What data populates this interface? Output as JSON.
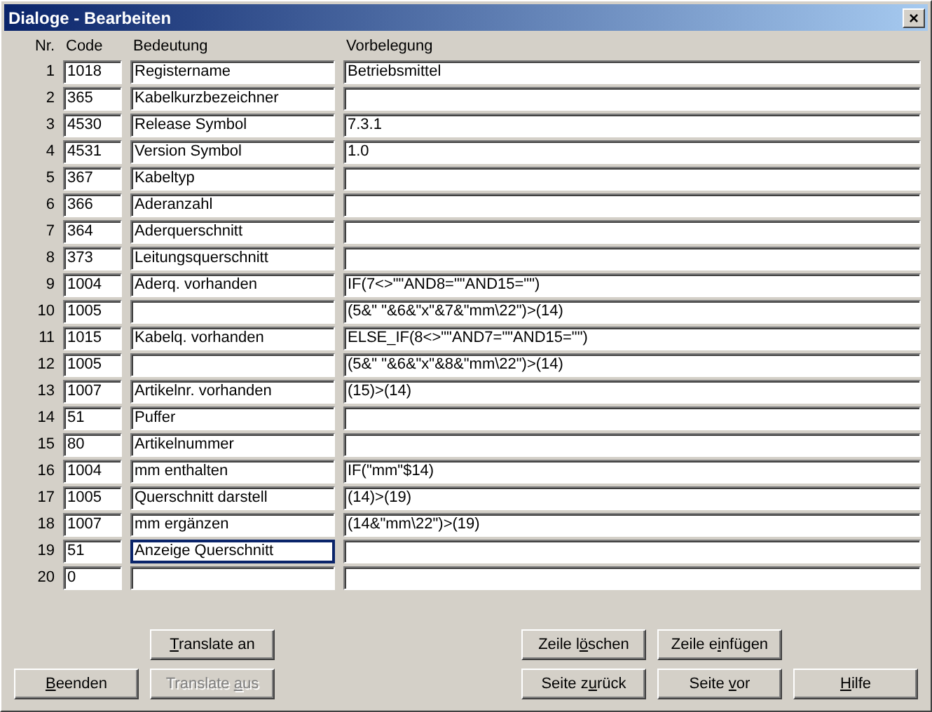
{
  "window": {
    "title": "Dialoge - Bearbeiten",
    "close": "×"
  },
  "columns": [
    "Nr.",
    "Code",
    "Bedeutung",
    "Vorbelegung"
  ],
  "rows": [
    {
      "nr": "1",
      "code": "1018",
      "bedeutung": "Registername",
      "vorbelegung": "Betriebsmittel",
      "focused": false
    },
    {
      "nr": "2",
      "code": "365",
      "bedeutung": "Kabelkurzbezeichner",
      "vorbelegung": "",
      "focused": false
    },
    {
      "nr": "3",
      "code": "4530",
      "bedeutung": "Release Symbol",
      "vorbelegung": "7.3.1",
      "focused": false
    },
    {
      "nr": "4",
      "code": "4531",
      "bedeutung": "Version  Symbol",
      "vorbelegung": "1.0",
      "focused": false
    },
    {
      "nr": "5",
      "code": "367",
      "bedeutung": "Kabeltyp",
      "vorbelegung": "",
      "focused": false
    },
    {
      "nr": "6",
      "code": "366",
      "bedeutung": "Aderanzahl",
      "vorbelegung": "",
      "focused": false
    },
    {
      "nr": "7",
      "code": "364",
      "bedeutung": "Aderquerschnitt",
      "vorbelegung": "",
      "focused": false
    },
    {
      "nr": "8",
      "code": "373",
      "bedeutung": "Leitungsquerschnitt",
      "vorbelegung": "",
      "focused": false
    },
    {
      "nr": "9",
      "code": "1004",
      "bedeutung": "Aderq. vorhanden",
      "vorbelegung": "IF(7<>\"\"AND8=\"\"AND15=\"\")",
      "focused": false
    },
    {
      "nr": "10",
      "code": "1005",
      "bedeutung": "",
      "vorbelegung": "(5&\" \"&6&\"x\"&7&\"mm\\22\")>(14)",
      "focused": false
    },
    {
      "nr": "11",
      "code": "1015",
      "bedeutung": "Kabelq. vorhanden",
      "vorbelegung": "ELSE_IF(8<>\"\"AND7=\"\"AND15=\"\")",
      "focused": false
    },
    {
      "nr": "12",
      "code": "1005",
      "bedeutung": "",
      "vorbelegung": "(5&\" \"&6&\"x\"&8&\"mm\\22\")>(14)",
      "focused": false
    },
    {
      "nr": "13",
      "code": "1007",
      "bedeutung": "Artikelnr. vorhanden",
      "vorbelegung": "(15)>(14)",
      "focused": false
    },
    {
      "nr": "14",
      "code": "51",
      "bedeutung": "Puffer",
      "vorbelegung": "",
      "focused": false
    },
    {
      "nr": "15",
      "code": "80",
      "bedeutung": "Artikelnummer",
      "vorbelegung": "",
      "focused": false
    },
    {
      "nr": "16",
      "code": "1004",
      "bedeutung": "mm enthalten",
      "vorbelegung": "IF(\"mm\"$14)",
      "focused": false
    },
    {
      "nr": "17",
      "code": "1005",
      "bedeutung": "Querschnitt darstell",
      "vorbelegung": "(14)>(19)",
      "focused": false
    },
    {
      "nr": "18",
      "code": "1007",
      "bedeutung": "mm ergänzen",
      "vorbelegung": "(14&\"mm\\22\")>(19)",
      "focused": false
    },
    {
      "nr": "19",
      "code": "51",
      "bedeutung": "Anzeige Querschnitt",
      "vorbelegung": "",
      "focused": true
    },
    {
      "nr": "20",
      "code": "0",
      "bedeutung": "",
      "vorbelegung": "",
      "focused": false
    }
  ],
  "buttons": [
    {
      "key": "T",
      "after": "ranslate an",
      "disabled": false
    },
    {
      "before": "Zeile l",
      "key": "ö",
      "after": "schen",
      "disabled": false
    },
    {
      "before": "Zeile e",
      "key": "i",
      "after": "nfügen",
      "disabled": false
    },
    {
      "key": "B",
      "after": "eenden",
      "disabled": false
    },
    {
      "before": "Translate ",
      "key": "a",
      "after": "us",
      "disabled": true
    },
    {
      "before": "Seite z",
      "key": "u",
      "after": "rück",
      "disabled": false
    },
    {
      "before": "Seite ",
      "key": "v",
      "after": "or",
      "disabled": false
    },
    {
      "key": "H",
      "after": "ilfe",
      "disabled": false
    }
  ]
}
